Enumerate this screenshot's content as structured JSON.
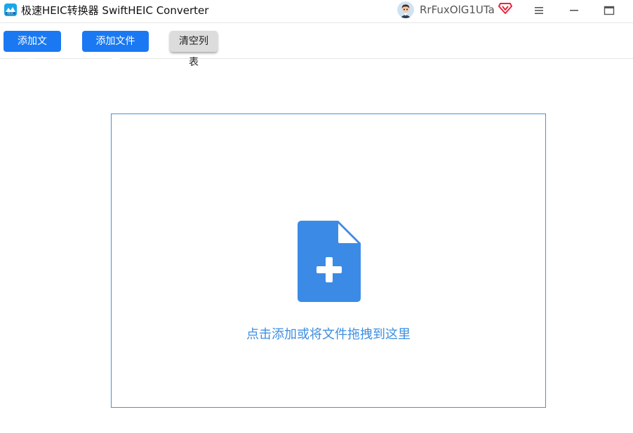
{
  "titlebar": {
    "app_icon": "heic-app-icon",
    "title": "极速HEIC转换器 SwiftHEIC Converter",
    "username": "RrFuxOlG1UTa",
    "vip_icon": "vip-diamond-icon",
    "menu_icon": "hamburger-icon",
    "minimize_icon": "minimize-icon",
    "maximize_icon": "maximize-icon"
  },
  "toolbar": {
    "add_file_label": "添加文件",
    "add_folder_label": "添加文件夹",
    "clear_list_label": "清空列表"
  },
  "dropzone": {
    "icon": "add-file-icon",
    "hint": "点击添加或将文件拖拽到这里"
  },
  "colors": {
    "accent": "#1a79f2",
    "dropzone_border": "#4a90d9",
    "icon_blue": "#3b8be6",
    "vip_red": "#e8253b"
  }
}
